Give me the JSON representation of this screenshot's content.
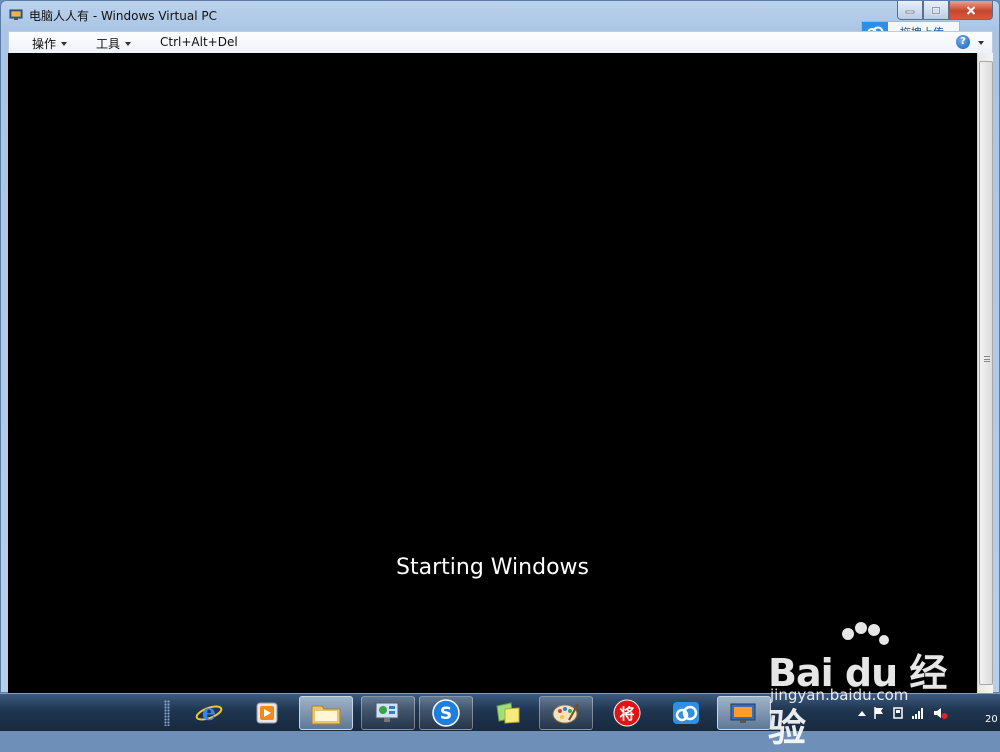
{
  "window": {
    "title": "电脑人人有 - Windows Virtual PC"
  },
  "baidu_upload": {
    "label": "拖拽上传"
  },
  "menubar": {
    "actions_label": "操作",
    "tools_label": "工具",
    "ctrl_alt_del_label": "Ctrl+Alt+Del",
    "help_label": "?"
  },
  "vm": {
    "boot_message": "Starting Windows"
  },
  "taskbar": {
    "pinned": [
      {
        "name": "internet-explorer",
        "glyph": "e"
      },
      {
        "name": "media-player",
        "glyph": "▶"
      },
      {
        "name": "file-explorer",
        "glyph": ""
      },
      {
        "name": "remote-desktop",
        "glyph": ""
      },
      {
        "name": "sogou",
        "glyph": "S"
      },
      {
        "name": "sticky-notes",
        "glyph": ""
      },
      {
        "name": "paint",
        "glyph": ""
      },
      {
        "name": "chess-game",
        "glyph": "将"
      },
      {
        "name": "baidu-cloud",
        "glyph": ""
      },
      {
        "name": "virtual-pc",
        "glyph": ""
      }
    ],
    "clock_text": "20"
  },
  "watermark": {
    "logo_text": "Bai du 经验",
    "url_text": "jingyan.baidu.com"
  },
  "colors": {
    "vm_background": "#000000",
    "boot_text": "#ffffff",
    "close_button": "#c8452c",
    "taskbar": "#1f3550"
  }
}
